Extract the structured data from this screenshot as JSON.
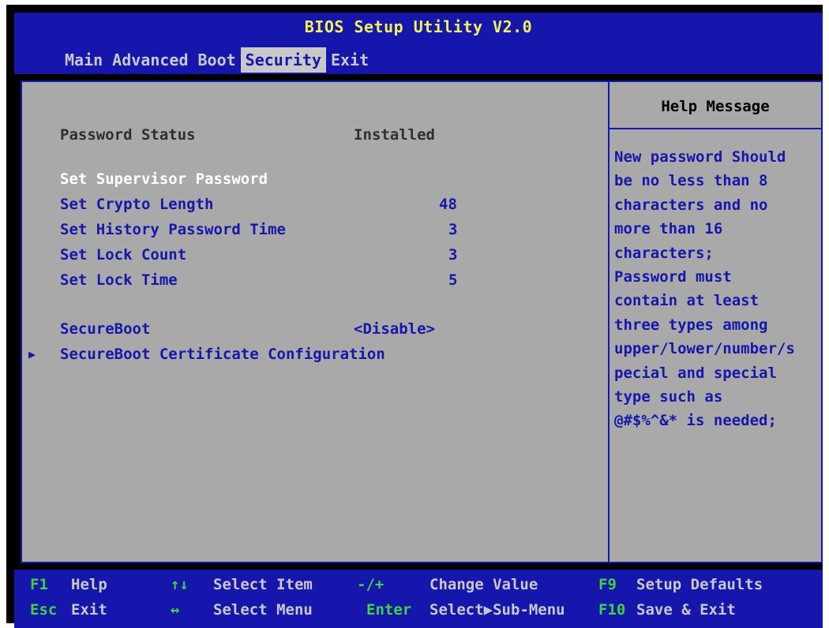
{
  "header": {
    "title": "BIOS Setup Utility V2.0",
    "tabs": [
      "Main",
      "Advanced",
      "Boot",
      "Security",
      "Exit"
    ],
    "active_tab": "Security"
  },
  "security": {
    "password_status_label": "Password Status",
    "password_status_value": "Installed",
    "set_supervisor_password": "Set Supervisor Password",
    "set_crypto_length_label": "Set Crypto Length",
    "set_crypto_length_value": "48",
    "set_history_password_time_label": "Set History Password Time",
    "set_history_password_time_value": "3",
    "set_lock_count_label": "Set Lock Count",
    "set_lock_count_value": "3",
    "set_lock_time_label": "Set Lock Time",
    "set_lock_time_value": "5",
    "secureboot_label": "SecureBoot",
    "secureboot_value": "<Disable>",
    "secureboot_cert_label": "SecureBoot Certificate Configuration"
  },
  "help": {
    "title": "Help Message",
    "lines": [
      "New password Should",
      "be no less than 8",
      "characters and no",
      "more than 16",
      "characters;",
      "Password must",
      "contain at least",
      "three types among",
      "upper/lower/number/s",
      "pecial and special",
      "type such as",
      "@#$%^&* is needed;"
    ]
  },
  "footer": {
    "f1_key": "F1",
    "f1_label": "Help",
    "updown_key": "↑↓",
    "updown_label": "Select Item",
    "plusminus_key": "-/+",
    "plusminus_label": "Change Value",
    "f9_key": "F9",
    "f9_label": "Setup Defaults",
    "esc_key": "Esc",
    "esc_label": "Exit",
    "leftright_key": "↔",
    "leftright_label": "Select Menu",
    "enter_key": "Enter",
    "enter_label": "Select▶Sub-Menu",
    "f10_key": "F10",
    "f10_label": "Save & Exit"
  },
  "colors": {
    "bios_blue": "#1616ad",
    "panel_gray": "#a9a9a9",
    "title_yellow": "#f2f255",
    "key_green": "#3fd33f"
  }
}
